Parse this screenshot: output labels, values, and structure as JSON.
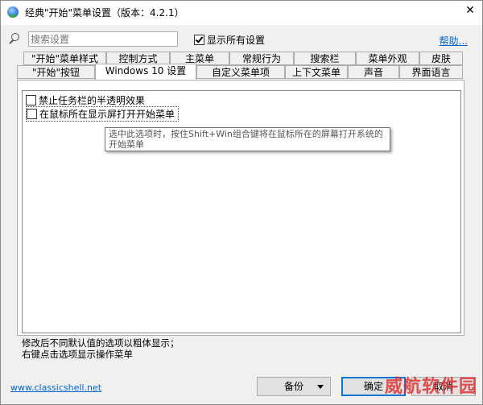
{
  "window": {
    "title": "经典\"开始\"菜单设置（版本：4.2.1）",
    "close_glyph": "✕"
  },
  "search": {
    "placeholder": "搜索设置",
    "value": ""
  },
  "show_all": {
    "label": "显示所有设置",
    "checked": true
  },
  "help": {
    "label": "帮助..."
  },
  "tabs": {
    "row1": [
      {
        "label": "\"开始\"菜单样式"
      },
      {
        "label": "控制方式"
      },
      {
        "label": "主菜单"
      },
      {
        "label": "常规行为"
      },
      {
        "label": "搜索栏"
      },
      {
        "label": "菜单外观"
      },
      {
        "label": "皮肤"
      }
    ],
    "row2": [
      {
        "label": "\"开始\"按钮"
      },
      {
        "label": "Windows 10 设置",
        "active": true
      },
      {
        "label": "自定义菜单项"
      },
      {
        "label": "上下文菜单"
      },
      {
        "label": "声音"
      },
      {
        "label": "界面语言"
      }
    ]
  },
  "options": [
    {
      "label": "禁止任务栏的半透明效果",
      "checked": false
    },
    {
      "label": "在鼠标所在显示屏打开开始菜单",
      "checked": false,
      "selected": true
    }
  ],
  "tooltip": {
    "text": "选中此选项时，按住Shift+Win组合键将在鼠标所在的屏幕打开系统的开始菜单"
  },
  "notes": {
    "line1": "修改后不同默认值的选项以粗体显示；",
    "line2": "右键点击选项显示操作菜单"
  },
  "footer": {
    "link": "www.classicshell.net",
    "backup": "备份",
    "ok": "确定",
    "cancel": "取消"
  },
  "watermark": {
    "text": "威航软件园"
  }
}
